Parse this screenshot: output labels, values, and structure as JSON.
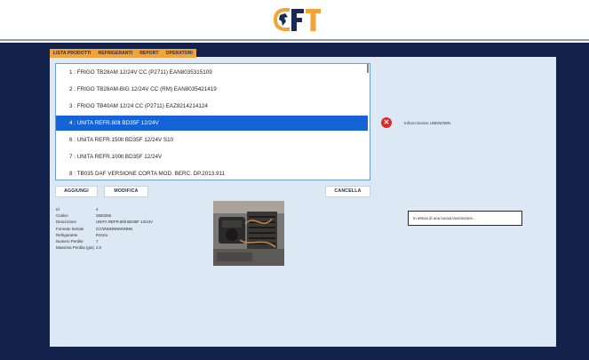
{
  "header": {
    "logo_text": "FT",
    "colors": {
      "brand_dark": "#1b2a52",
      "brand_orange": "#f2a33a",
      "selected": "#1464d8"
    }
  },
  "tabs": [
    {
      "label": "LISTA PRODOTTI"
    },
    {
      "label": "REFRIGERANTI"
    },
    {
      "label": "REPORT"
    },
    {
      "label": "OPERATORI"
    }
  ],
  "products": [
    {
      "label": "1 : FRIGO TB28AM 12/24V CC (P2711) EAN8035315109"
    },
    {
      "label": "2 : FRIGO TB28AM-BIG 12/24V CC (RM) EAN8035421419"
    },
    {
      "label": "3 : FRIGO TB40AM 12/24 CC (P2711) EAZ8214214124"
    },
    {
      "label": "4 : UNITA REFR.80lt BD35F 12/24V",
      "selected": true
    },
    {
      "label": "6 : UNITA REFR.150lt BD35F 12/24V          S10"
    },
    {
      "label": "7 : UNITA REFR.100lt BD35F 12/24V"
    },
    {
      "label": "8 : TB035 DAF VERSIONE CORTA MOD. BERC. DP.2013.911"
    }
  ],
  "buttons": {
    "add": "AGGIUNGI",
    "edit": "MODIFICA",
    "delete": "CANCELLA"
  },
  "details": [
    {
      "label": "Id",
      "value": "4"
    },
    {
      "label": "Codice",
      "value": "3650256"
    },
    {
      "label": "Descrizione",
      "value": "UNITA REFR.80lt BD35F 12/24V"
    },
    {
      "label": "Formato Seriale",
      "value": "CCNNNNNNNNNNN"
    },
    {
      "label": "Refrigerante",
      "value": "R410a"
    },
    {
      "label": "Numero Perdite",
      "value": "7"
    },
    {
      "label": "Massima Perdita (g/a)",
      "value": "2.0"
    }
  ],
  "device": {
    "status_icon": "error-x-icon",
    "status_text": "Inficon Device UNKNOWN"
  },
  "message": {
    "text": "In attesa di una nuova lavorazione..."
  }
}
